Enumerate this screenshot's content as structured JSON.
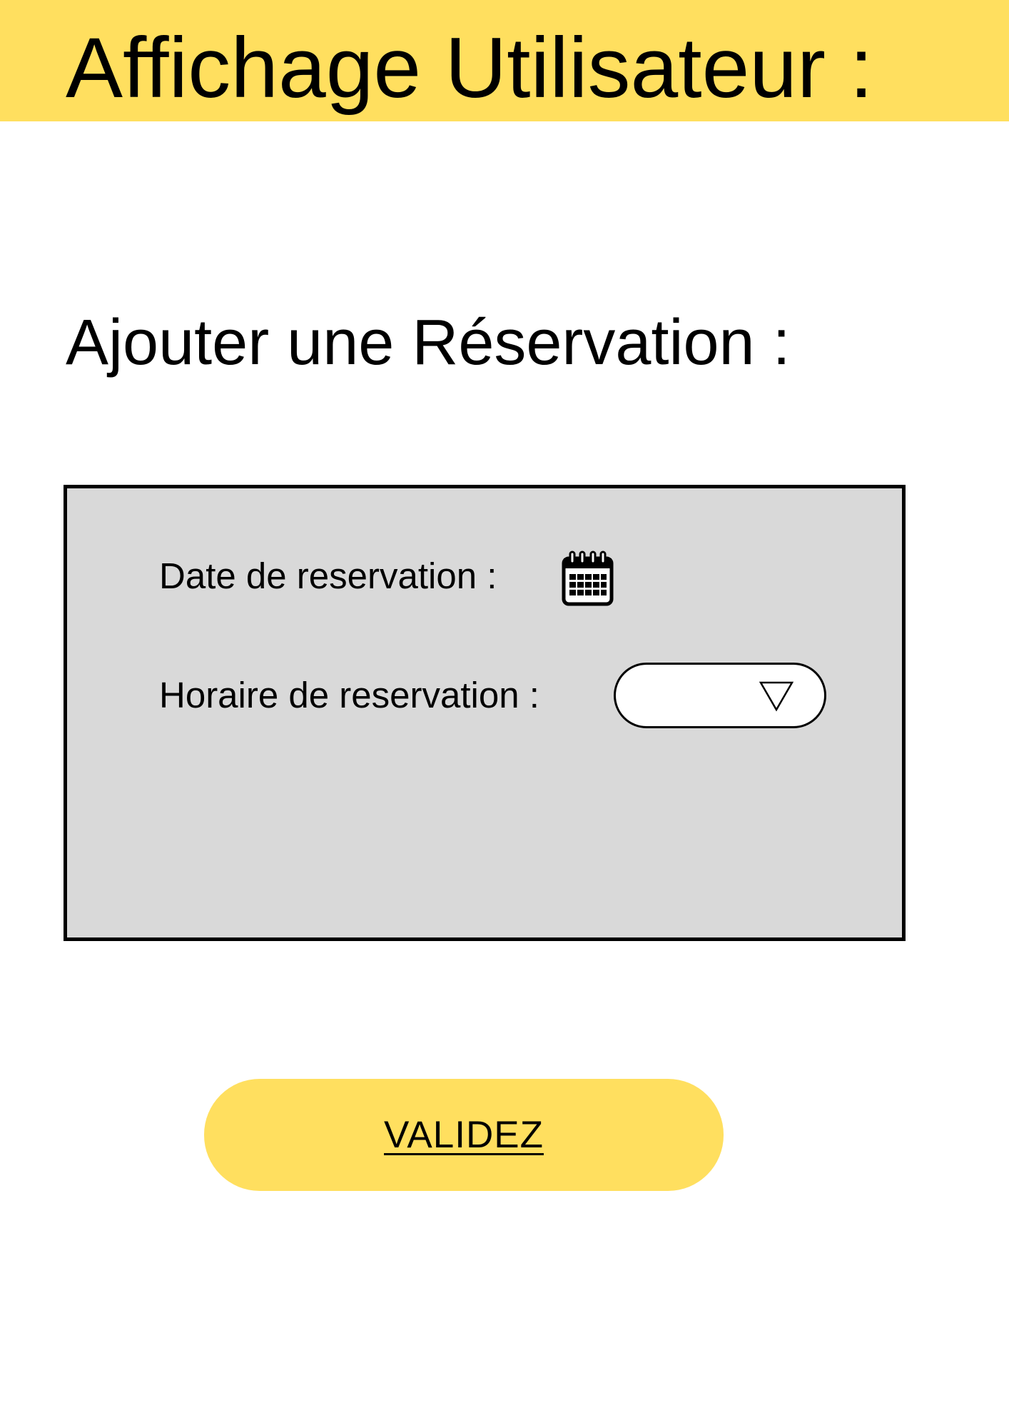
{
  "header": {
    "title": "Affichage Utilisateur :"
  },
  "main": {
    "heading": "Ajouter une Réservation :"
  },
  "form": {
    "date_label": "Date de reservation :",
    "date_icon": "calendar-icon",
    "time_label": "Horaire de reservation :",
    "time_select_value": "",
    "time_select_icon": "triangle-down-icon"
  },
  "actions": {
    "validate_label": "VALIDEZ"
  },
  "colors": {
    "accent": "#FFDF5F",
    "panel_background": "#D9D9D9",
    "border": "#000000",
    "page_background": "#FFFFFF"
  }
}
